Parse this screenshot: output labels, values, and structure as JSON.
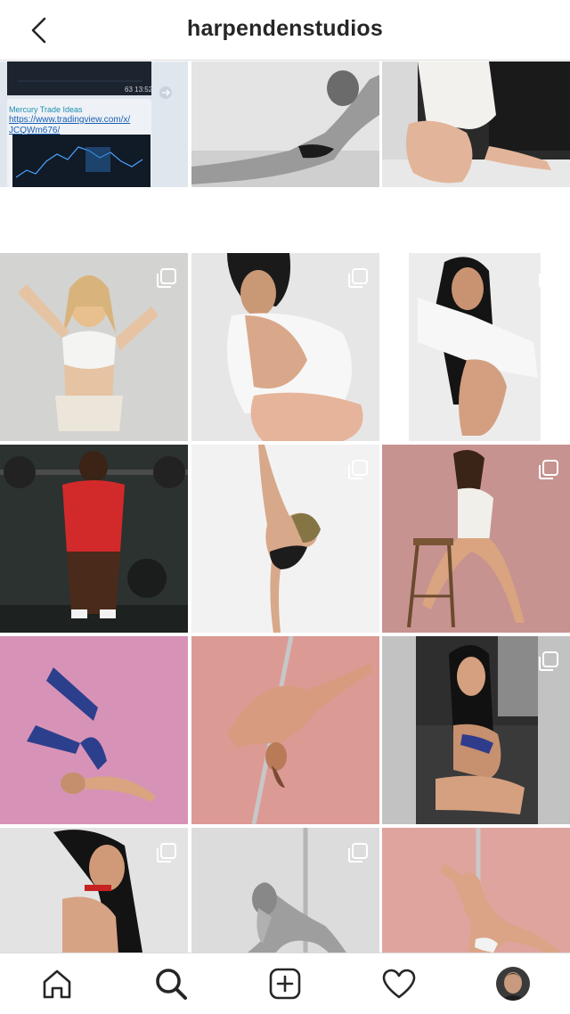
{
  "header": {
    "title": "harpendenstudios",
    "back_icon": "chevron-left-icon"
  },
  "first_tile": {
    "post_title": "Mercury Trade Ideas",
    "link_line1": "https://www.tradingview.com/x/",
    "link_line2": "JCQWm676/",
    "time": "63 13:52"
  },
  "tabs": [
    {
      "name": "home",
      "icon": "home-icon"
    },
    {
      "name": "search",
      "icon": "search-icon",
      "active": true
    },
    {
      "name": "new-post",
      "icon": "add-post-icon"
    },
    {
      "name": "activity",
      "icon": "heart-icon"
    },
    {
      "name": "profile",
      "icon": "avatar"
    }
  ],
  "colors": {
    "text": "#262626",
    "divider": "#dbdbdb",
    "link": "#1a5fb4"
  }
}
